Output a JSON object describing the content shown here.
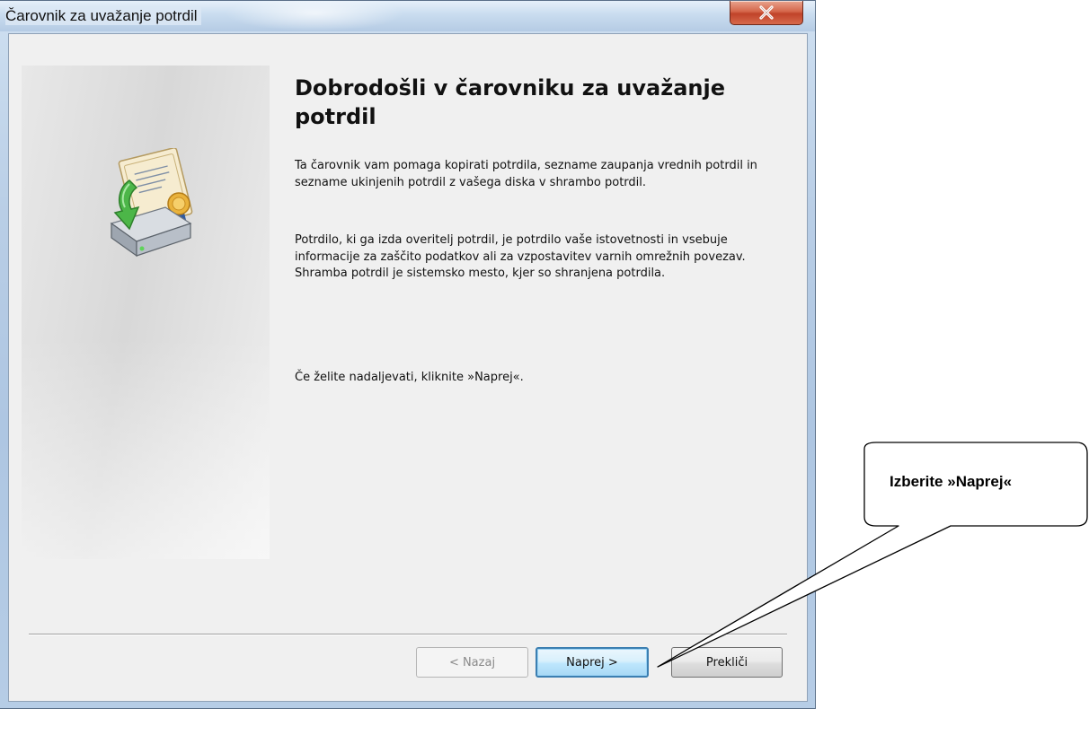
{
  "window": {
    "title": "Čarovnik za uvažanje potrdil",
    "close_icon": "close-icon"
  },
  "main": {
    "heading": "Dobrodošli v čarovniku za uvažanje potrdil",
    "paragraph1": "Ta čarovnik vam pomaga kopirati potrdila, sezname zaupanja vrednih potrdil in sezname ukinjenih potrdil z vašega diska v shrambo potrdil.",
    "paragraph2": "Potrdilo, ki ga izda overitelj potrdil, je potrdilo vaše istovetnosti in vsebuje informacije za zaščito podatkov ali za vzpostavitev varnih omrežnih povezav. Shramba potrdil je sistemsko mesto, kjer so shranjena potrdila.",
    "paragraph3": "Če želite nadaljevati, kliknite »Naprej«.",
    "icon": "certificate-import-icon"
  },
  "buttons": {
    "back": "< Nazaj",
    "next": "Naprej >",
    "cancel": "Prekliči"
  },
  "callout": {
    "text": "Izberite »Naprej«"
  }
}
